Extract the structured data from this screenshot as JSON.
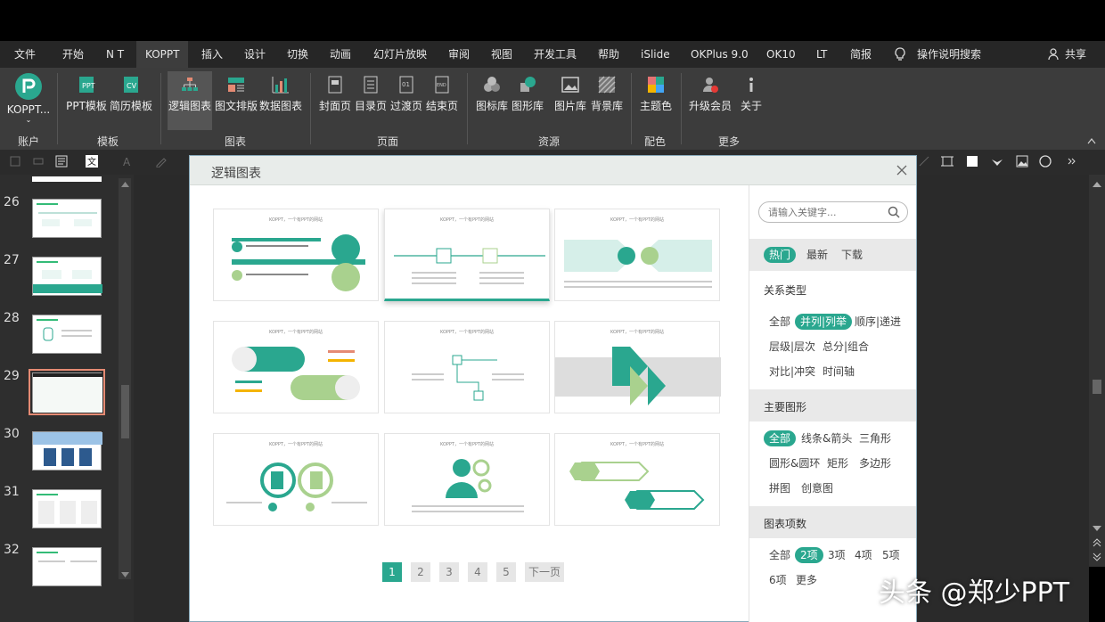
{
  "colors": {
    "accent": "#2aa78f",
    "menubar": "#262626",
    "ribbon": "#3c3c3c",
    "selected_thumb": "#e58a73"
  },
  "menu": {
    "items": [
      "文件",
      "开始",
      "N T",
      "KOPPT",
      "插入",
      "设计",
      "切换",
      "动画",
      "幻灯片放映",
      "审阅",
      "视图",
      "开发工具",
      "帮助",
      "iSlide",
      "OKPlus 9.0",
      "OK10",
      "LT",
      "简报"
    ],
    "search_label": "操作说明搜索",
    "share_label": "共享"
  },
  "ribbon": {
    "buttons": {
      "koppt": "KOPPT...",
      "ppt_template": "PPT模板",
      "resume_template": "简历模板",
      "logic_chart": "逻辑图表",
      "text_layout": "图文排版",
      "data_chart": "数据图表",
      "cover": "封面页",
      "toc": "目录页",
      "transition": "过渡页",
      "end": "结束页",
      "icon_lib": "图标库",
      "shape_lib": "图形库",
      "image_lib": "图片库",
      "bg_lib": "背景库",
      "theme_color": "主题色",
      "upgrade": "升级会员",
      "about": "关于"
    },
    "groups": {
      "account": "账户",
      "template": "模板",
      "chart": "图表",
      "page": "页面",
      "resource": "资源",
      "color": "配色",
      "more": "更多"
    }
  },
  "slides": [
    {
      "num": "26"
    },
    {
      "num": "27"
    },
    {
      "num": "28"
    },
    {
      "num": "29"
    },
    {
      "num": "30"
    },
    {
      "num": "31"
    },
    {
      "num": "32"
    }
  ],
  "dialog": {
    "title": "逻辑图表",
    "card_title": "KOPPT，一个有PPT的网站",
    "pages": [
      "1",
      "2",
      "3",
      "4",
      "5"
    ],
    "next_page": "下一页",
    "search_placeholder": "请输入关键字...",
    "sort_tabs": [
      "热门",
      "最新",
      "下载"
    ],
    "relation": {
      "title": "关系类型",
      "tags": [
        "全部",
        "并列|列举",
        "顺序|递进",
        "层级|层次",
        "总分|组合",
        "对比|冲突",
        "时间轴"
      ]
    },
    "shape": {
      "title": "主要图形",
      "tags": [
        "全部",
        "线条&箭头",
        "三角形",
        "圆形&圆环",
        "矩形",
        "多边形",
        "拼图",
        "创意图"
      ]
    },
    "count": {
      "title": "图表项数",
      "tags": [
        "全部",
        "2项",
        "3项",
        "4项",
        "5项",
        "6项",
        "更多"
      ]
    }
  },
  "watermark": "头条 @郑少PPT"
}
